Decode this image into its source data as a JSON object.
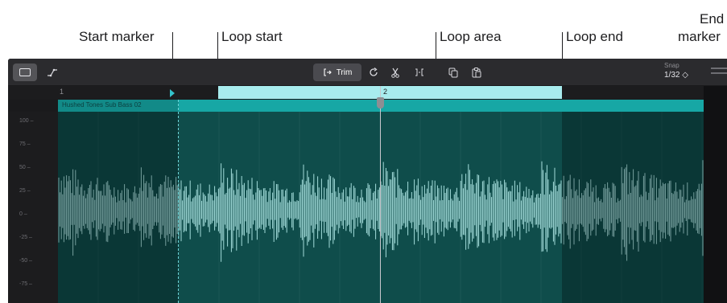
{
  "callouts": {
    "start_marker": "Start marker",
    "loop_start": "Loop start",
    "loop_area": "Loop area",
    "loop_end": "Loop end",
    "end_marker_line1": "End",
    "end_marker_line2": "marker"
  },
  "toolbar": {
    "view_icon": "rectangle-view-icon",
    "automation_icon": "automation-curve-icon",
    "trim_label": "Trim",
    "loop_icon": "loop-icon",
    "split_icon": "scissors-icon",
    "join_icon": "join-icon",
    "copy_icon": "copy-icon",
    "paste_icon": "paste-icon",
    "snap_label": "Snap",
    "snap_value": "1/32 ◇"
  },
  "ruler": {
    "bar_1": "1",
    "bar_2": "2"
  },
  "region": {
    "name": "Hushed Tones Sub Bass 02"
  },
  "amplitude_axis": [
    "100",
    "75",
    "50",
    "25",
    "0",
    "-25",
    "-50",
    "-75"
  ],
  "colors": {
    "loop_area": "#a8ecee",
    "region_header": "#17a7a5",
    "waveform": "#a3dcda",
    "region_body": "#0f4d4b"
  }
}
